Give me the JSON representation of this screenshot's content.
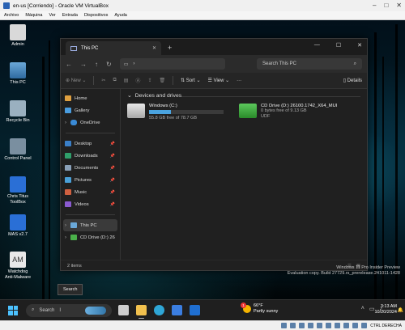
{
  "vbox": {
    "title": "en-us [Corriendo] - Oracle VM VirtualBox",
    "menu": [
      "Archivo",
      "Máquina",
      "Ver",
      "Entrada",
      "Dispositivos",
      "Ayuda"
    ],
    "host_key": "CTRL DERECHA"
  },
  "desktop": {
    "icons": [
      {
        "label": "Admin",
        "icon": "folder-user-icon",
        "color": "#d9d9d9"
      },
      {
        "label": "This PC",
        "icon": "computer-icon",
        "color": "#6aa8d8"
      },
      {
        "label": "Recycle Bin",
        "icon": "recycle-bin-icon",
        "color": "#9ab0c0"
      },
      {
        "label": "Control Panel",
        "icon": "control-panel-icon",
        "color": "#7a8fa0"
      },
      {
        "label": "Chris Titus ToolBox",
        "icon": "toolbox-icon",
        "color": "#2a6fd6"
      },
      {
        "label": "MAS v2.7",
        "icon": "mas-icon",
        "color": "#2a6fd6"
      },
      {
        "label": "Watchdog Anti-Malware",
        "icon": "watchdog-icon",
        "color": "#e8e8e8"
      }
    ],
    "watermark_line1": "Windows 11 Pro Insider Preview",
    "watermark_line2": "Evaluation copy. Build 27729.rs_prerelease.241011-1428"
  },
  "explorer": {
    "tab_title": "This PC",
    "search_placeholder": "Search This PC",
    "toolbar": {
      "new_label": "New",
      "sort_label": "Sort",
      "view_label": "View",
      "more_label": "···",
      "details_label": "Details"
    },
    "nav": [
      {
        "label": "Home",
        "icon": "home-icon",
        "color": "#e0a040",
        "pinned": false,
        "chevron": false
      },
      {
        "label": "Gallery",
        "icon": "gallery-icon",
        "color": "#4a9de0",
        "pinned": false,
        "chevron": false
      },
      {
        "label": "OneDrive",
        "icon": "onedrive-icon",
        "color": "#3a8ad6",
        "pinned": false,
        "chevron": true
      }
    ],
    "quick_access": [
      {
        "label": "Desktop",
        "icon": "desktop-icon",
        "color": "#3a7fc8"
      },
      {
        "label": "Downloads",
        "icon": "downloads-icon",
        "color": "#2f9e6a"
      },
      {
        "label": "Documents",
        "icon": "documents-icon",
        "color": "#8aa0b8"
      },
      {
        "label": "Pictures",
        "icon": "pictures-icon",
        "color": "#4aa0d8"
      },
      {
        "label": "Music",
        "icon": "music-icon",
        "color": "#d06040"
      },
      {
        "label": "Videos",
        "icon": "videos-icon",
        "color": "#8a5ad0"
      }
    ],
    "tree": [
      {
        "label": "This PC",
        "icon": "computer-icon",
        "color": "#6aa8d8",
        "selected": true
      },
      {
        "label": "CD Drive (D:) 26",
        "icon": "cd-drive-icon",
        "color": "#4ab04a",
        "selected": false
      }
    ],
    "group_title": "Devices and drives",
    "drives": [
      {
        "name": "Windows (C:)",
        "free": "55.8 GB free of 78.7 GB",
        "used_fraction": 0.29,
        "fs": "",
        "icon": "hard-drive-icon",
        "color": "#c8c8c8"
      },
      {
        "name": "CD Drive (D:) 26100.1742_X64_MUI",
        "free": "0 bytes free of 9.13 GB",
        "used_fraction": null,
        "fs": "UDF",
        "icon": "cd-drive-icon",
        "color": "#3aa63a"
      }
    ],
    "status_items": "2 items"
  },
  "tooltip": "Search",
  "taskbar": {
    "search_label": "Search",
    "apps": [
      {
        "name": "task-view-icon",
        "color": "#cfcfcf",
        "running": false
      },
      {
        "name": "file-explorer-icon",
        "color": "#f2c14e",
        "running": true
      },
      {
        "name": "edge-icon",
        "color": "#2fa6d6",
        "running": false
      },
      {
        "name": "store-icon",
        "color": "#3b7ee0",
        "running": false
      },
      {
        "name": "outlook-icon",
        "color": "#1f6fd1",
        "running": false
      }
    ],
    "weather_temp": "66°F",
    "weather_desc": "Partly sunny",
    "weather_badge": "1",
    "time": "3:13 AM",
    "date": "10/20/2024"
  }
}
